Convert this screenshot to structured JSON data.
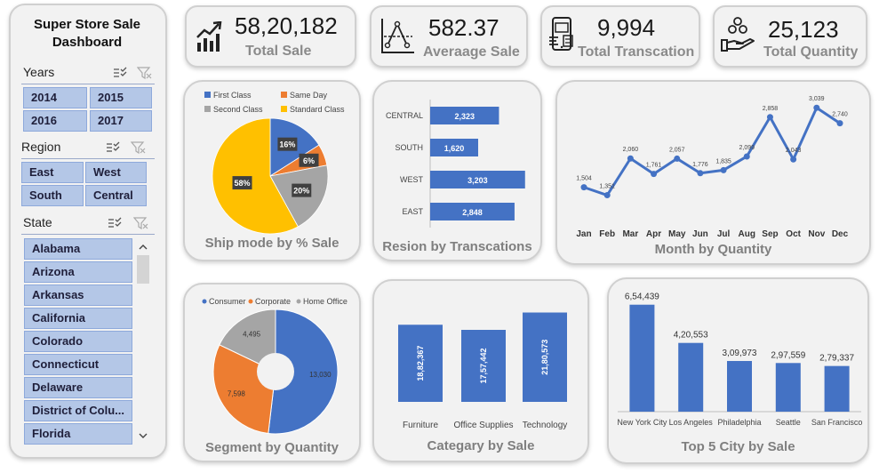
{
  "sidebar": {
    "title_line1": "Super Store Sale",
    "title_line2": "Dashboard",
    "years": {
      "label": "Years",
      "items": [
        "2014",
        "2015",
        "2016",
        "2017"
      ]
    },
    "region": {
      "label": "Region",
      "items": [
        "East",
        "West",
        "South",
        "Central"
      ]
    },
    "state": {
      "label": "State",
      "items": [
        "Alabama",
        "Arizona",
        "Arkansas",
        "California",
        "Colorado",
        "Connecticut",
        "Delaware",
        "District of Colu...",
        "Florida"
      ]
    },
    "icons": [
      "multi-select-icon",
      "clear-filter-icon",
      "scroll-up-icon",
      "scroll-down-icon"
    ]
  },
  "kpis": [
    {
      "value": "58,20,182",
      "label": "Total Sale",
      "icon": "growth-chart-icon"
    },
    {
      "value": "582.37",
      "label": "Averaage Sale",
      "icon": "average-graph-icon"
    },
    {
      "value": "9,994",
      "label": "Total Transcation",
      "icon": "mobile-payment-icon"
    },
    {
      "value": "25,123",
      "label": "Total Quantity",
      "icon": "hand-coins-icon"
    }
  ],
  "colors": {
    "blue": "#4472c4",
    "orange": "#ed7d31",
    "gray": "#a5a5a5",
    "yellow": "#ffc000",
    "slicer": "#b4c7e7",
    "card": "#f2f2f2"
  },
  "chart_data": [
    {
      "type": "pie",
      "title": "Ship mode by % Sale",
      "legend": "top",
      "labels": [
        "First Class",
        "Same Day",
        "Second Class",
        "Standard Class"
      ],
      "values": [
        16,
        6,
        20,
        58
      ],
      "value_labels": [
        "16%",
        "6%",
        "20%",
        "58%"
      ]
    },
    {
      "type": "bar",
      "orientation": "horizontal",
      "title": "Resion by Transcations",
      "categories": [
        "CENTRAL",
        "SOUTH",
        "WEST",
        "EAST"
      ],
      "values": [
        2323,
        1620,
        3203,
        2848
      ],
      "value_labels": [
        "2,323",
        "1,620",
        "3,203",
        "2,848"
      ],
      "xlim": [
        0,
        3300
      ]
    },
    {
      "type": "line",
      "title": "Month by Quantity",
      "categories": [
        "Jan",
        "Feb",
        "Mar",
        "Apr",
        "May",
        "Jun",
        "Jul",
        "Aug",
        "Sep",
        "Oct",
        "Nov",
        "Dec"
      ],
      "values": [
        1504,
        1351,
        2060,
        1761,
        2057,
        1776,
        1835,
        2099,
        2858,
        2043,
        3039,
        2740
      ],
      "value_labels": [
        "1,504",
        "1,351",
        "2,060",
        "1,761",
        "2,057",
        "1,776",
        "1,835",
        "2,099",
        "2,858",
        "2,043",
        "3,039",
        "2,740"
      ],
      "ylim": [
        1000,
        3300
      ]
    },
    {
      "type": "pie",
      "subtype": "donut",
      "title": "Segment by Quantity",
      "legend": "top",
      "labels": [
        "Consumer",
        "Corporate",
        "Home Office"
      ],
      "values": [
        13030,
        7598,
        4495
      ],
      "value_labels": [
        "13,030",
        "7,598",
        "4,495"
      ]
    },
    {
      "type": "bar",
      "title": "Categary by Sale",
      "categories": [
        "Furniture",
        "Office Supplies",
        "Technology"
      ],
      "values": [
        1882367,
        1757442,
        2180573
      ],
      "value_labels": [
        "18,82,367",
        "17,57,442",
        "21,80,573"
      ],
      "ylim": [
        0,
        2300000
      ]
    },
    {
      "type": "bar",
      "title": "Top 5 City by Sale",
      "categories": [
        "New York City",
        "Los Angeles",
        "Philadelphia",
        "Seattle",
        "San Francisco"
      ],
      "values": [
        654439,
        420553,
        309973,
        297559,
        279337
      ],
      "value_labels": [
        "6,54,439",
        "4,20,553",
        "3,09,973",
        "2,97,559",
        "2,79,337"
      ],
      "ylim": [
        0,
        680000
      ]
    }
  ]
}
